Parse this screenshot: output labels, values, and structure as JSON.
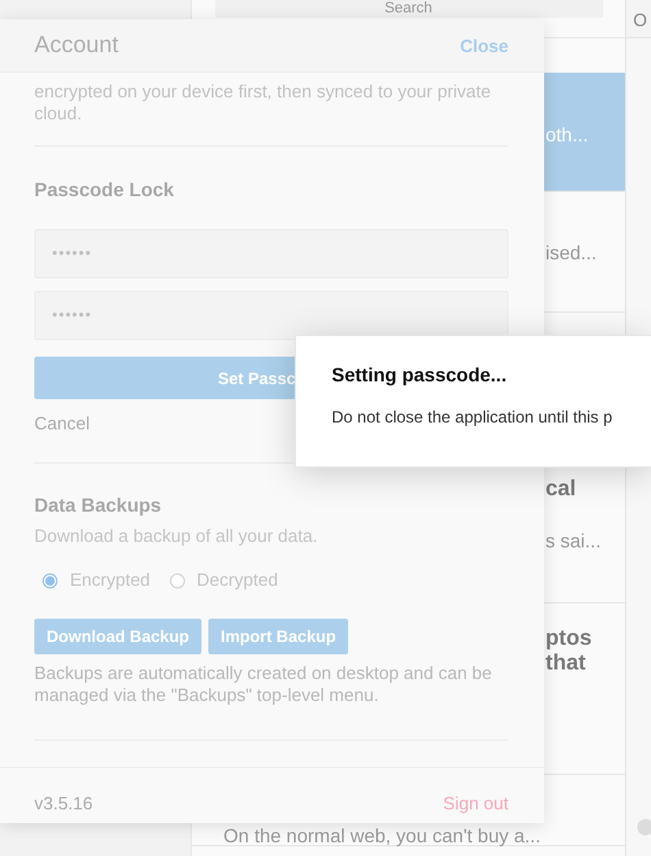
{
  "background": {
    "search": {
      "placeholder": "Search"
    },
    "column_3": "O",
    "notes": [
      {
        "snippet": "oth...",
        "selected": true
      },
      {
        "snippet": "ised...",
        "selected": false
      },
      {
        "title": "cal",
        "snippet": "s sai...",
        "selected": false
      },
      {
        "title": "ptos that",
        "selected": false
      },
      {
        "snippet": "On the normal web, you can't buy a...",
        "selected": false
      }
    ]
  },
  "account": {
    "title": "Account",
    "close": "Close",
    "intro": "encrypted on your device first, then synced to your private cloud.",
    "passcode": {
      "heading": "Passcode Lock",
      "fields": [
        {
          "value": "••••••"
        },
        {
          "value": "••••••"
        }
      ],
      "button": "Set Passc",
      "cancel": "Cancel"
    },
    "backups": {
      "heading": "Data Backups",
      "description": "Download a backup of all your data.",
      "formats": [
        {
          "label": "Encrypted",
          "selected": true
        },
        {
          "label": "Decrypted",
          "selected": false
        }
      ],
      "buttons": [
        "Download Backup",
        "Import Backup"
      ],
      "note": "Backups are automatically created on desktop and can be managed via the \"Backups\" top-level menu."
    },
    "version": "v3.5.16",
    "sign_out": "Sign out"
  },
  "dialog": {
    "title": "Setting passcode...",
    "message": "Do not close the application until this p"
  }
}
